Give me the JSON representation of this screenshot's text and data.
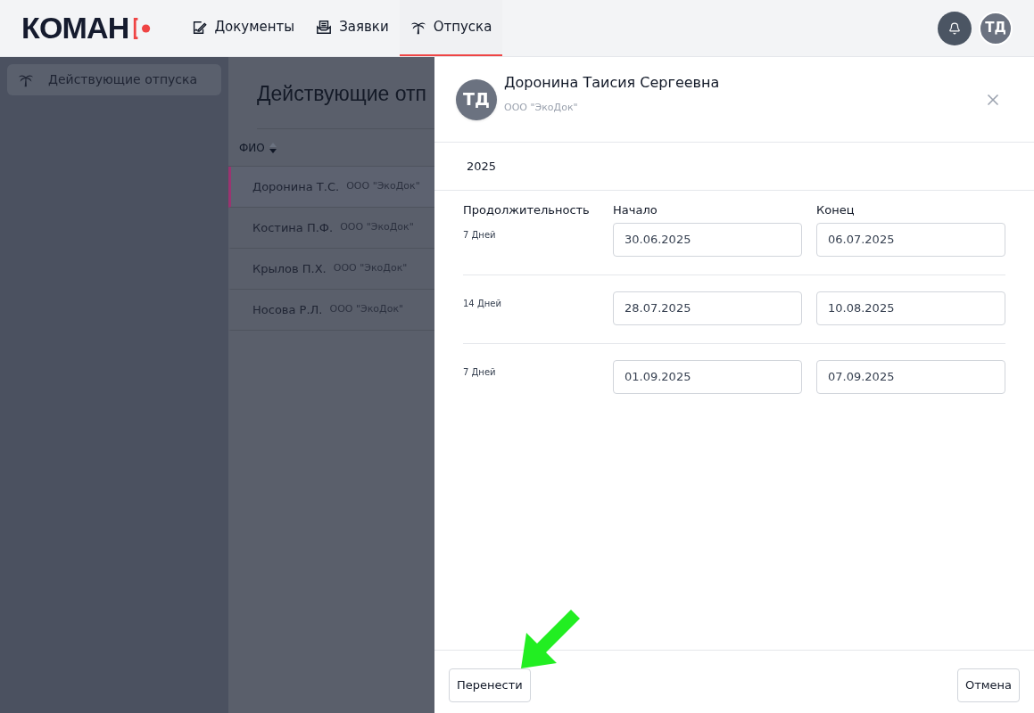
{
  "logo": {
    "text": "КОМАН"
  },
  "nav": [
    {
      "label": "Документы",
      "kind": "documents",
      "selected": false
    },
    {
      "label": "Заявки",
      "kind": "requests",
      "selected": false
    },
    {
      "label": "Отпуска",
      "kind": "vacations",
      "selected": true
    }
  ],
  "user": {
    "initials": "ТД"
  },
  "sidebar": {
    "items": [
      {
        "label": "Действующие отпуска",
        "selected": true
      }
    ]
  },
  "page": {
    "title": "Действующие отп"
  },
  "table": {
    "columns": [
      {
        "label": "ФИО"
      }
    ],
    "rows": [
      {
        "name": "Доронина Т.С.",
        "company": "ООО \"ЭкоДок\"",
        "selected": true
      },
      {
        "name": "Костина П.Ф.",
        "company": "ООО \"ЭкоДок\"",
        "selected": false
      },
      {
        "name": "Крылов П.Х.",
        "company": "ООО \"ЭкоДок\"",
        "selected": false
      },
      {
        "name": "Носова Р.Л.",
        "company": "ООО \"ЭкоДок\"",
        "selected": false
      }
    ]
  },
  "drawer": {
    "initials": "ТД",
    "name": "Доронина Таисия Сергеевна",
    "company": "ООО \"ЭкоДок\"",
    "year": "2025",
    "columns": [
      "Продолжительность",
      "Начало",
      "Конец"
    ],
    "periods": [
      {
        "duration": "7 Дней",
        "start": "30.06.2025",
        "end": "06.07.2025"
      },
      {
        "duration": "14 Дней",
        "start": "28.07.2025",
        "end": "10.08.2025"
      },
      {
        "duration": "7 Дней",
        "start": "01.09.2025",
        "end": "07.09.2025"
      }
    ],
    "buttons": [
      "Перенести",
      "Отмена"
    ]
  }
}
